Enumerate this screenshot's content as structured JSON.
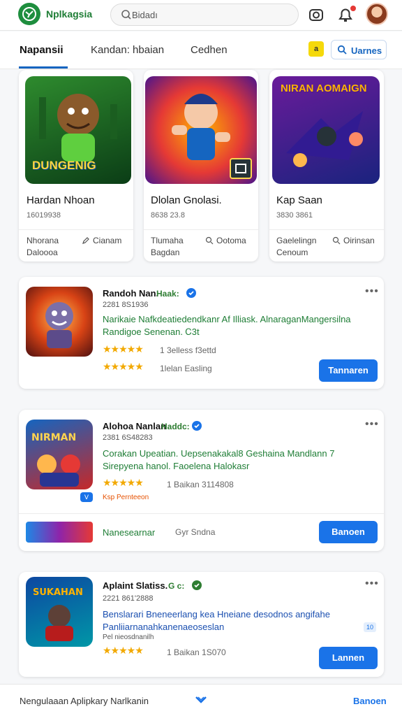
{
  "header": {
    "app_name": "Nplkagsia",
    "search_icon": "search-icon",
    "search_text": "Bidadı",
    "icons": [
      "camera-icon",
      "notification-bell-icon",
      "avatar"
    ]
  },
  "tabs": {
    "items": [
      "Napansii",
      "Kandan: hbaian",
      "Cedhen"
    ],
    "active_index": 0,
    "chip_label": "a",
    "manage_label": "Uarnes"
  },
  "featured": [
    {
      "art_text": "DUNGENIG",
      "title": "Hardan Nhoan",
      "sub": "16019938",
      "left_line1": "Nhorana",
      "left_line2": "Daloooa",
      "right_label": "Cianam"
    },
    {
      "art_text": "",
      "title": "Dlolan Gnolasi.",
      "sub": "8638 23.8",
      "left_line1": "Tlumaha",
      "left_line2": "Bagdan",
      "right_label": "Ootoma"
    },
    {
      "art_text": "NIRAN AOMAIGN",
      "title": "Kap Saan",
      "sub": "3830 3861",
      "left_line1": "Gaelelingn",
      "left_line2": "Cenoum",
      "right_label": "Oirinsan"
    }
  ],
  "list": [
    {
      "title": "Randoh Nan.",
      "tag": "Haak:",
      "meta": "2281 8S1936",
      "desc_line1": "Narikaie Nafkdeatiedendkanr Af Illiask. AlnaraganMangersilna",
      "desc_line2": "Randigoe Senenan. Ꮯ3t",
      "rating1": 4.5,
      "count1": "1 3elless f3ettd",
      "rating2": 5,
      "count2": "1lelan Easling",
      "button": "Tannaren"
    },
    {
      "title": "Alohoa Nanlan",
      "tag": "Haddc:",
      "meta": "2381 6S48283",
      "desc_line1": "Corakan Upeatian. Uepsenakakal8 Geshaina Mandlann 7",
      "desc_line2": "Sirepyena hanol. Faoelena Halokasr",
      "rating1": 4.5,
      "count1": "1 Baikan 3114808",
      "badge_text": "Ksp Pernteeon",
      "badge_chip": "ᐯ",
      "note": "Nanesearnar",
      "note_tail": "Gyr Sndna",
      "button": "Banoen"
    },
    {
      "title": "Aplaint Slatiss.",
      "tag": "G c:",
      "meta": "2221 861'2888",
      "desc_line1": "Benslarari Bneneerlang kea Hneiane desodnos angifahe",
      "desc_line2": "Panliiarnanahkanenaeoseslan",
      "small_line": "Pel nieosdnanilh",
      "rating1": 5,
      "count1": "1 Baikan 1S070",
      "mini_chip": "10",
      "button": "Lannen"
    }
  ],
  "bottom": {
    "left_label": "Nengulaaan Aplipkary Narlkanin",
    "right_label": "Banoen"
  }
}
